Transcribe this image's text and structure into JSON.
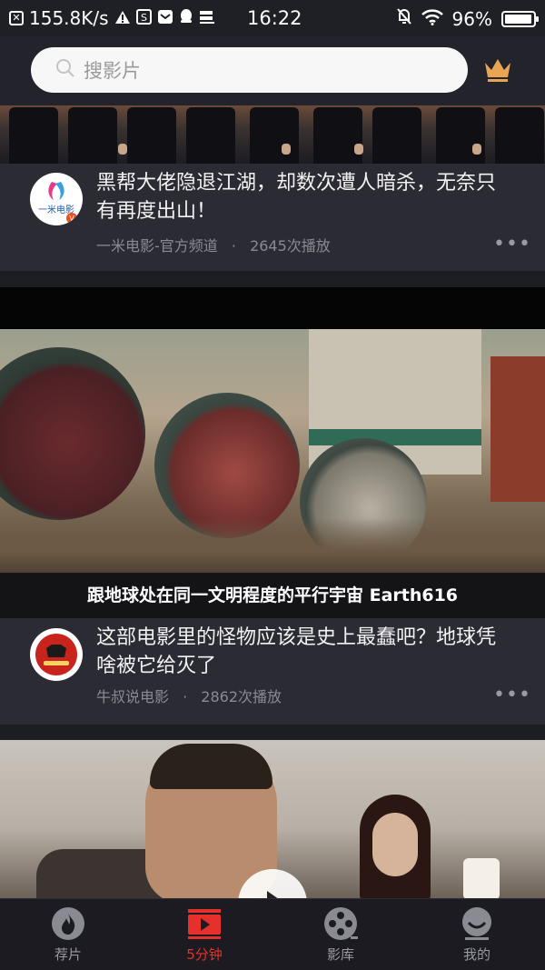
{
  "status_bar": {
    "net_speed": "155.8K/s",
    "time": "16:22",
    "battery": "96%",
    "icons": [
      "close-box-icon",
      "warning-icon",
      "app-s-icon",
      "mail-icon",
      "qq-icon",
      "storage-icon",
      "mute-bell-icon",
      "wifi-icon",
      "battery-icon"
    ]
  },
  "header": {
    "search_placeholder": "搜影片",
    "vip_icon": "crown-icon"
  },
  "feed": [
    {
      "title": "黑帮大佬隐退江湖，却数次遭人暗杀，无奈只有再度出山！",
      "channel": "一米电影-官方频道",
      "plays": "2645次播放",
      "avatar_text": "一米电影",
      "more": "•••"
    },
    {
      "subtitle": "跟地球处在同一文明程度的平行宇宙 Earth616",
      "title": "这部电影里的怪物应该是史上最蠢吧？地球凭啥被它给灭了",
      "channel": "牛叔说电影",
      "plays": "2862次播放",
      "more": "•••"
    }
  ],
  "meta_separator": "·",
  "bottom_nav": {
    "items": [
      {
        "label": "荐片",
        "icon": "flame-icon"
      },
      {
        "label": "5分钟",
        "icon": "play-video-icon"
      },
      {
        "label": "影库",
        "icon": "film-reel-icon"
      },
      {
        "label": "我的",
        "icon": "profile-icon"
      }
    ],
    "active_index": 1
  },
  "colors": {
    "background": "#23232b",
    "card": "#2b2b33",
    "accent": "#e5302c",
    "crown": "#e9a553",
    "muted_text": "#8a8a92"
  }
}
